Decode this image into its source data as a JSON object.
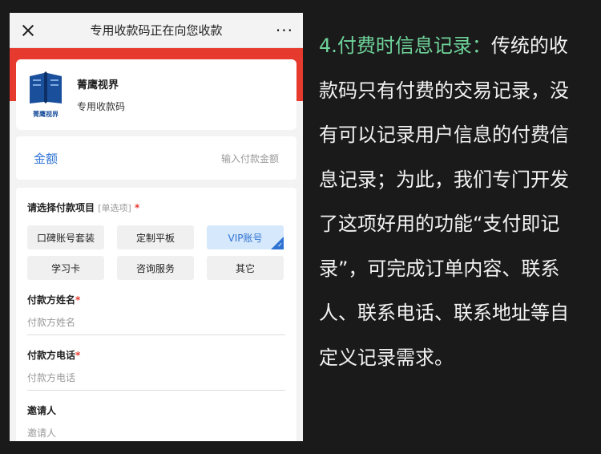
{
  "phone": {
    "topbar": {
      "title": "专用收款码正在向您收款",
      "more": "···"
    },
    "merchant": {
      "name": "菁鹰视界",
      "subtitle": "专用收款码",
      "logo_text": "菁鹰视界"
    },
    "amount": {
      "label": "金额",
      "placeholder": "输入付款金额"
    },
    "form": {
      "project": {
        "title": "请选择付款项目",
        "hint": "[单选项]",
        "required": "*"
      },
      "options": [
        {
          "label": "口碑账号套装",
          "selected": false
        },
        {
          "label": "定制平板",
          "selected": false
        },
        {
          "label": "VIP账号",
          "selected": true
        },
        {
          "label": "学习卡",
          "selected": false
        },
        {
          "label": "咨询服务",
          "selected": false
        },
        {
          "label": "其它",
          "selected": false
        }
      ],
      "fields": [
        {
          "label": "付款方姓名",
          "required": "*",
          "placeholder": "付款方姓名"
        },
        {
          "label": "付款方电话",
          "required": "*",
          "placeholder": "付款方电话"
        },
        {
          "label": "邀请人",
          "required": "",
          "placeholder": "邀请人"
        }
      ]
    }
  },
  "description": {
    "heading": "4.付费时信息记录：",
    "body": "传统的收款码只有付费的交易记录，没有可以记录用户信息的付费信息记录；为此，我们专门开发了这项好用的功能“支付即记录”，可完成订单内容、联系人、联系电话、联系地址等自定义记录需求。"
  },
  "colors": {
    "brand_red": "#e73a2e",
    "link_blue": "#2e73d4",
    "accent_green": "#6fd39a",
    "background": "#1a1a1a"
  },
  "icons": {
    "close": "close-icon",
    "more": "more-icon",
    "logo": "book-logo-icon",
    "selected": "check-corner-icon"
  }
}
